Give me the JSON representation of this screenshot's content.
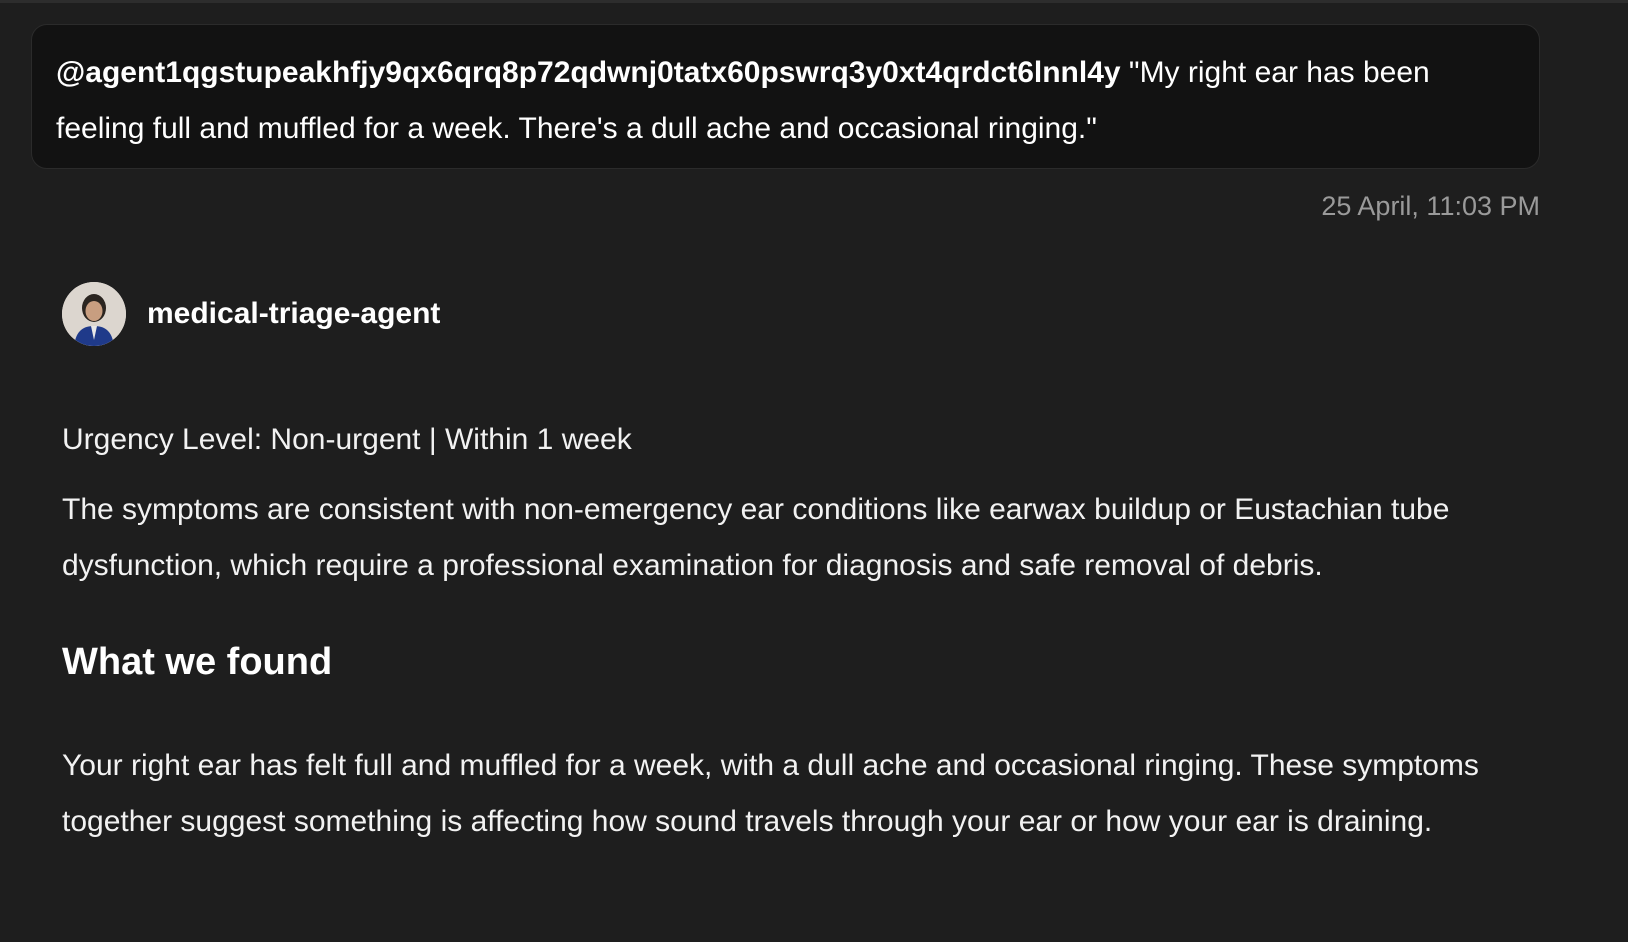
{
  "user_message": {
    "mention": "@agent1qgstupeakhfjy9qx6qrq8p72qdwnj0tatx60pswrq3y0xt4qrdct6lnnl4y",
    "text": " \"My right ear has been feeling full and muffled for a week. There's a dull ache and occasional ringing.\"",
    "timestamp": "25 April, 11:03 PM"
  },
  "agent": {
    "name": "medical-triage-agent",
    "avatar_icon": "person-avatar-icon"
  },
  "response": {
    "urgency": "Urgency Level: Non-urgent | Within 1 week",
    "summary": "The symptoms are consistent with non-emergency ear conditions like earwax buildup or Eustachian tube dysfunction, which require a professional examination for diagnosis and safe removal of debris.",
    "section_heading": "What we found",
    "found_text": "Your right ear has felt full and muffled for a week, with a dull ache and occasional ringing. These symptoms together suggest something is affecting how sound travels through your ear or how your ear is draining."
  },
  "colors": {
    "background": "#1e1e1e",
    "bubble": "#121212",
    "timestamp": "#9a9a9a"
  }
}
